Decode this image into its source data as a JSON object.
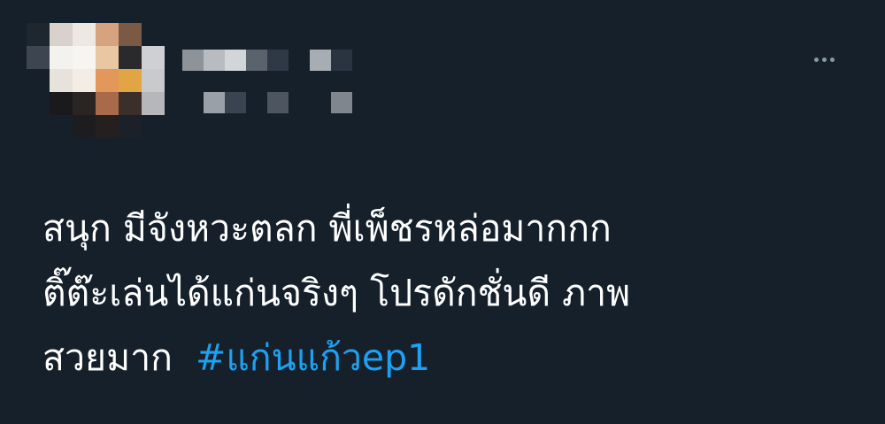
{
  "tweet": {
    "author_name": "",
    "author_handle": "",
    "more_label": "•••",
    "text_lines": [
      "สนุก มีจังหวะตลก พี่เพ็ชรหล่อมากกก",
      "ติ๊ต๊ะเล่นได้แก่นจริงๆ โปรดักชั่นดี ภาพ",
      "สวยมาก"
    ],
    "hashtag": "#แก่นแก้วep1"
  },
  "colors": {
    "background": "#15202b",
    "text": "#ffffff",
    "hashtag": "#1da1f2",
    "secondary": "#8899a6"
  },
  "icons": {
    "more": "more-horizontal-icon",
    "avatar": "avatar-pixelated"
  }
}
